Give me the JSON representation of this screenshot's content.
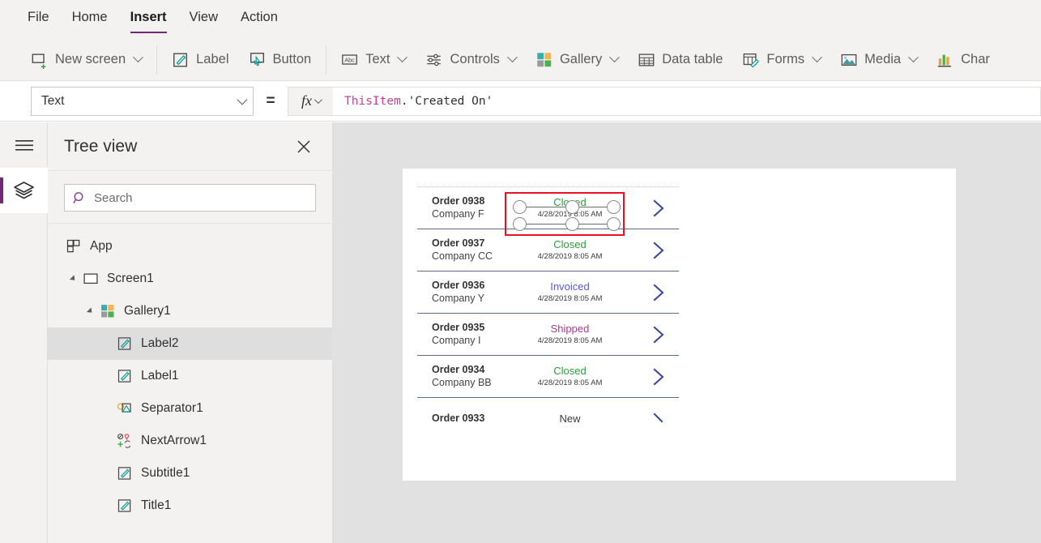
{
  "menu": {
    "tabs": [
      {
        "label": "File",
        "active": false
      },
      {
        "label": "Home",
        "active": false
      },
      {
        "label": "Insert",
        "active": true
      },
      {
        "label": "View",
        "active": false
      },
      {
        "label": "Action",
        "active": false
      }
    ]
  },
  "ribbon": {
    "items": [
      {
        "label": "New screen",
        "icon": "new-screen-icon",
        "caret": true
      },
      {
        "label": "Label",
        "icon": "label-icon",
        "caret": false
      },
      {
        "label": "Button",
        "icon": "button-icon",
        "caret": false
      },
      {
        "label": "Text",
        "icon": "text-abc-icon",
        "caret": true
      },
      {
        "label": "Controls",
        "icon": "controls-sliders-icon",
        "caret": true
      },
      {
        "label": "Gallery",
        "icon": "gallery-grid-icon",
        "caret": true
      },
      {
        "label": "Data table",
        "icon": "data-table-icon",
        "caret": false
      },
      {
        "label": "Forms",
        "icon": "forms-icon",
        "caret": true
      },
      {
        "label": "Media",
        "icon": "media-image-icon",
        "caret": true
      },
      {
        "label": "Char",
        "icon": "charts-icon",
        "caret": false
      }
    ]
  },
  "formula_bar": {
    "property": "Text",
    "equals": "=",
    "fx_label": "fx",
    "formula_token": "ThisItem",
    "formula_rest": ".'Created On'"
  },
  "rail": {
    "menu_button": "hamburger-menu-icon",
    "tree_button": "layers-icon"
  },
  "tree_panel": {
    "title": "Tree view",
    "close_label": "✕",
    "search": {
      "placeholder": "Search",
      "value": ""
    },
    "items": [
      {
        "label": "App",
        "indent": 0,
        "icon": "app-icon",
        "twisty": "none",
        "selected": false
      },
      {
        "label": "Screen1",
        "indent": 1,
        "icon": "screen-icon",
        "twisty": "open",
        "selected": false
      },
      {
        "label": "Gallery1",
        "indent": 2,
        "icon": "gallery-icon",
        "twisty": "open",
        "selected": false
      },
      {
        "label": "Label2",
        "indent": 3,
        "icon": "label-icon",
        "twisty": "none",
        "selected": true
      },
      {
        "label": "Label1",
        "indent": 3,
        "icon": "label-icon",
        "twisty": "none",
        "selected": false
      },
      {
        "label": "Separator1",
        "indent": 3,
        "icon": "separator-icon",
        "twisty": "none",
        "selected": false
      },
      {
        "label": "NextArrow1",
        "indent": 3,
        "icon": "nextarrow-icon",
        "twisty": "none",
        "selected": false
      },
      {
        "label": "Subtitle1",
        "indent": 3,
        "icon": "label-icon",
        "twisty": "none",
        "selected": false
      },
      {
        "label": "Title1",
        "indent": 3,
        "icon": "label-icon",
        "twisty": "none",
        "selected": false
      }
    ]
  },
  "canvas": {
    "gallery": {
      "rows": [
        {
          "title": "Order 0938",
          "subtitle": "Company F",
          "status": "Closed",
          "status_color": "#2e9e3e",
          "date": "4/28/2019 8:05 AM",
          "selected": true,
          "clipped": false
        },
        {
          "title": "Order 0937",
          "subtitle": "Company CC",
          "status": "Closed",
          "status_color": "#2e9e3e",
          "date": "4/28/2019 8:05 AM",
          "selected": false,
          "clipped": false
        },
        {
          "title": "Order 0936",
          "subtitle": "Company Y",
          "status": "Invoiced",
          "status_color": "#5b5bd6",
          "date": "4/28/2019 8:05 AM",
          "selected": false,
          "clipped": false
        },
        {
          "title": "Order 0935",
          "subtitle": "Company I",
          "status": "Shipped",
          "status_color": "#b4379b",
          "date": "4/28/2019 8:05 AM",
          "selected": false,
          "clipped": false
        },
        {
          "title": "Order 0934",
          "subtitle": "Company BB",
          "status": "Closed",
          "status_color": "#2e9e3e",
          "date": "4/28/2019 8:05 AM",
          "selected": false,
          "clipped": false
        },
        {
          "title": "Order 0933",
          "subtitle": "",
          "status": "New",
          "status_color": "#3b3b3b",
          "date": "",
          "selected": false,
          "clipped": true
        }
      ]
    }
  },
  "colors": {
    "accent_purple": "#742774",
    "selection_red": "#e81123",
    "chevron_blue": "#3b4c9e",
    "separator_navy": "#5b6b8c"
  }
}
